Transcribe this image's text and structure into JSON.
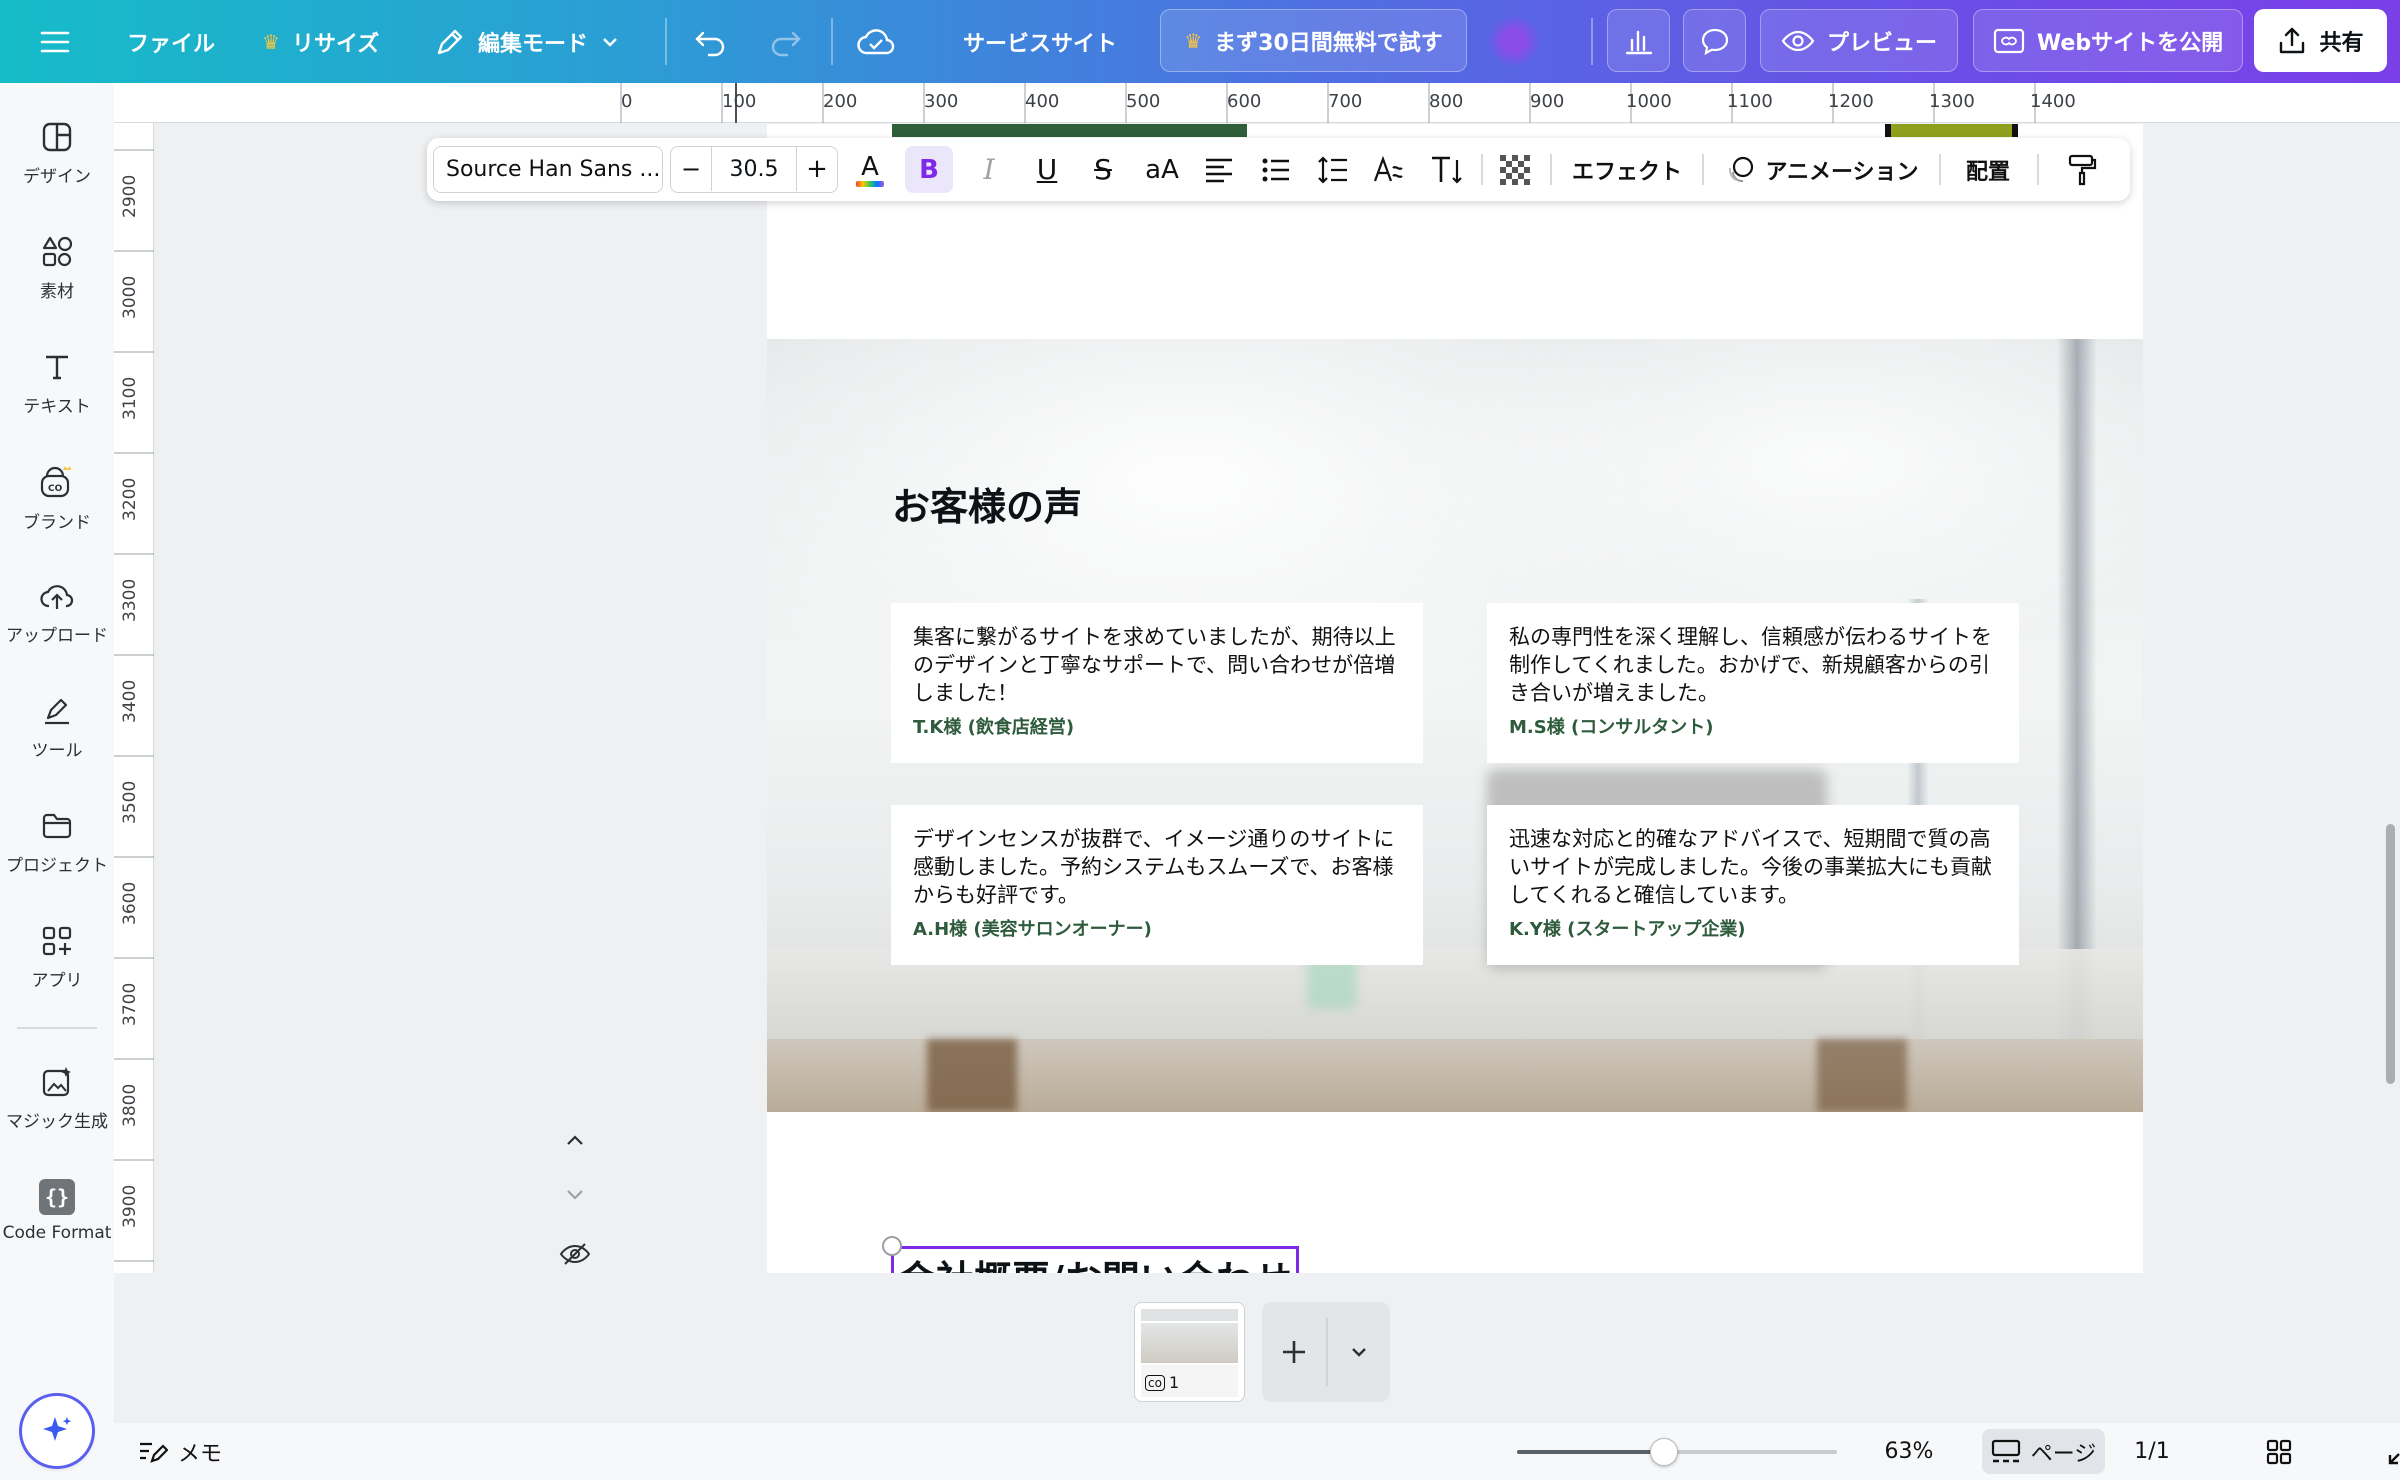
{
  "topbar": {
    "file": "ファイル",
    "resize": "リサイズ",
    "edit_mode": "編集モード",
    "site_name": "サービスサイト",
    "trial": "まず30日間無料で試す",
    "preview": "プレビュー",
    "publish": "Webサイトを公開",
    "share": "共有"
  },
  "rail": {
    "items": [
      {
        "label": "デザイン"
      },
      {
        "label": "素材"
      },
      {
        "label": "テキスト"
      },
      {
        "label": "ブランド"
      },
      {
        "label": "アップロード"
      },
      {
        "label": "ツール"
      },
      {
        "label": "プロジェクト"
      },
      {
        "label": "アプリ"
      },
      {
        "label": "マジック生成"
      },
      {
        "label": "Code Format"
      }
    ]
  },
  "ruler_top": [
    "0",
    "100",
    "200",
    "300",
    "400",
    "500",
    "600",
    "700",
    "800",
    "900",
    "1000",
    "1100",
    "1200",
    "1300",
    "1400"
  ],
  "ruler_left": [
    "2900",
    "3000",
    "3100",
    "3200",
    "3300",
    "3400",
    "3500",
    "3600",
    "3700",
    "3800",
    "3900"
  ],
  "text_toolbar": {
    "font": "Source Han Sans ...",
    "minus": "−",
    "size": "30.5",
    "plus": "+",
    "bold": "B",
    "italic": "I",
    "underline": "U",
    "strike": "S",
    "case": "aA",
    "effects": "エフェクト",
    "animation": "アニメーション",
    "position": "配置"
  },
  "section": {
    "title": "お客様の声",
    "testimonials": [
      {
        "text": "集客に繋がるサイトを求めていましたが、期待以上のデザインと丁寧なサポートで、問い合わせが倍増しました！",
        "author": "T.K様 (飲食店経営)"
      },
      {
        "text": "私の専門性を深く理解し、信頼感が伝わるサイトを制作してくれました。おかげで、新規顧客からの引き合いが増えました。",
        "author": "M.S様 (コンサルタント)"
      },
      {
        "text": "デザインセンスが抜群で、イメージ通りのサイトに感動しました。予約システムもスムーズで、お客様からも好評です。",
        "author": "A.H様 (美容サロンオーナー)"
      },
      {
        "text": "迅速な対応と的確なアドバイスで、短期間で質の高いサイトが完成しました。今後の事業拡大にも貢献してくれると確信しています。",
        "author": "K.Y様 (スタートアップ企業)"
      }
    ],
    "next_title": "会社概要/お問い合わせ"
  },
  "pages": {
    "thumb_number": "1"
  },
  "statusbar": {
    "memo": "メモ",
    "zoom": "63%",
    "zoom_fraction": 0.46,
    "page_label": "ページ",
    "page_count": "1/1"
  },
  "colors": {
    "accent": "#7d2ae8",
    "author_green": "#2e5b3c",
    "green_bar": "#2f5e3a",
    "olive_bar": "#8ea01c"
  }
}
